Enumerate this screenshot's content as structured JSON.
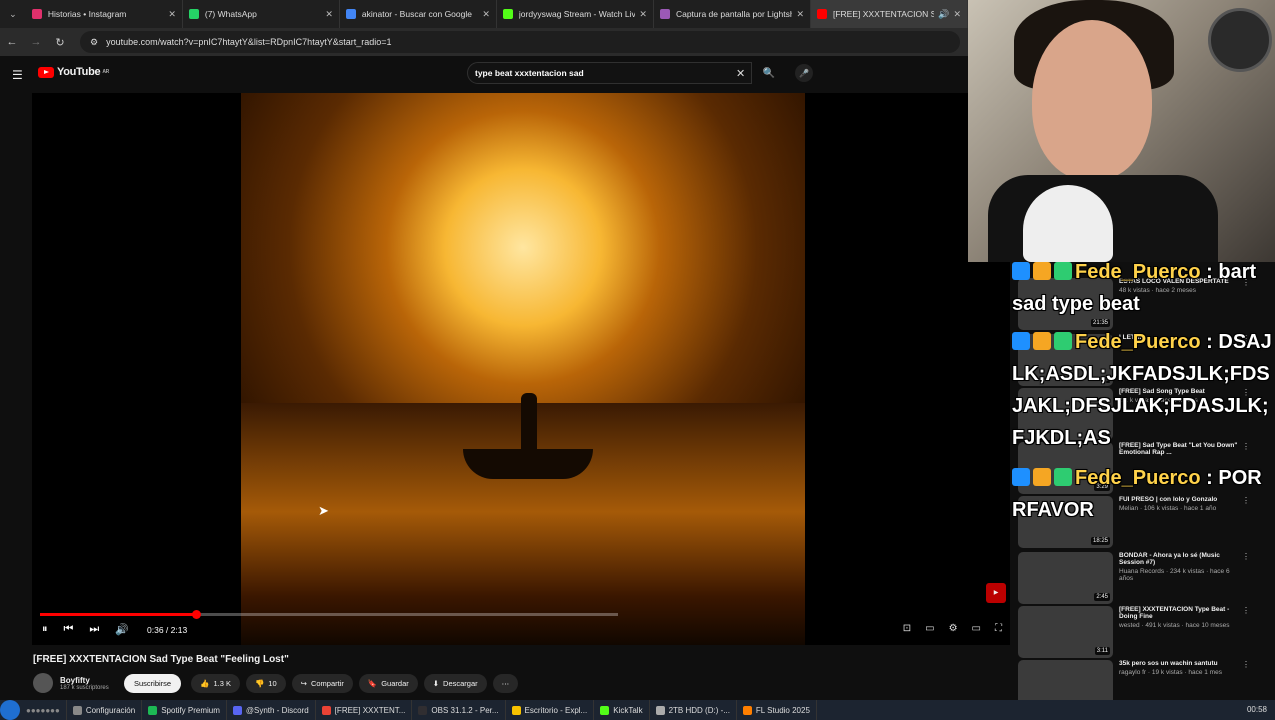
{
  "browser": {
    "tabs": [
      {
        "label": "Historias • Instagram",
        "color": "#e1306c"
      },
      {
        "label": "(7) WhatsApp",
        "color": "#25d366"
      },
      {
        "label": "akinator - Buscar con Google",
        "color": "#4285f4"
      },
      {
        "label": "jordyyswag Stream - Watch Liv",
        "color": "#53fc18"
      },
      {
        "label": "Captura de pantalla por Lightsh",
        "color": "#9b59b6"
      },
      {
        "label": "[FREE] XXXTENTACION Sad",
        "color": "#ff0000"
      }
    ],
    "url": "youtube.com/watch?v=pnIC7htaytY&list=RDpnIC7htaytY&start_radio=1"
  },
  "youtube": {
    "logo": "YouTube",
    "region": "AR",
    "search_value": "type beat xxxtentacion sad"
  },
  "player": {
    "time": "0:36 / 2:13",
    "progress_fraction": 0.27
  },
  "video": {
    "title": "[FREE] XXXTENTACION Sad Type Beat \"Feeling Lost\"",
    "channel": "Boyfifty",
    "subscribers": "187 k suscriptores",
    "subscribe_label": "Suscribirse",
    "likes": "1.3 K",
    "dislikes": "10",
    "share_label": "Compartir",
    "save_label": "Guardar",
    "download_label": "Descargar"
  },
  "recommendations": [
    {
      "title": "ESTAS LOCO VALEN DESPERTATE",
      "meta": "48 k vistas · hace 2 meses",
      "duration": "21:35"
    },
    {
      "title": "I LETHA",
      "meta": "",
      "duration": ""
    },
    {
      "title": "[FREE] Sad Song Type Beat",
      "meta": "2.1 k vistas · hace 6 meses",
      "duration": ""
    },
    {
      "title": "[FREE] Sad Type Beat \"Let You Down\" Emotional Rap ...",
      "meta": "",
      "duration": "3:29"
    },
    {
      "title": "FUI PRESO | con lolo y Gonzalo",
      "meta": "Melian · 106 k vistas · hace 1 año",
      "duration": "18:25"
    },
    {
      "title": "BONDAR - Ahora ya lo sé (Music Session #7)",
      "meta": "Huana Records · 234 k vistas · hace 6 años",
      "duration": "2:45"
    },
    {
      "title": "[FREE] XXXTENTACION Type Beat - Doing Fine",
      "meta": "wested · 491 k vistas · hace 10 meses",
      "duration": "3:11"
    },
    {
      "title": "35k pero sos un wachin santutu",
      "meta": "ragaylo fr · 19 k vistas · hace 1 mes",
      "duration": ""
    }
  ],
  "chat": [
    {
      "user": "Fede_Puerco",
      "message": "bart sad type beat"
    },
    {
      "user": "Fede_Puerco",
      "message": "DSAJLK;ASDL;JKFADSJLK;FDSJAKL;DFSJLAK;FDASJLK;FJKDL;AS"
    },
    {
      "user": "Fede_Puerco",
      "message": "POR RFAVOR"
    }
  ],
  "taskbar": {
    "items": [
      "Configuración",
      "Spotify Premium",
      "@Synth - Discord",
      "[FREE] XXXTENT...",
      "OBS 31.1.2 - Per...",
      "Escritorio - Expl...",
      "KickTalk",
      "2TB HDD (D:) -...",
      "FL Studio 2025"
    ],
    "clock": "00:58"
  }
}
